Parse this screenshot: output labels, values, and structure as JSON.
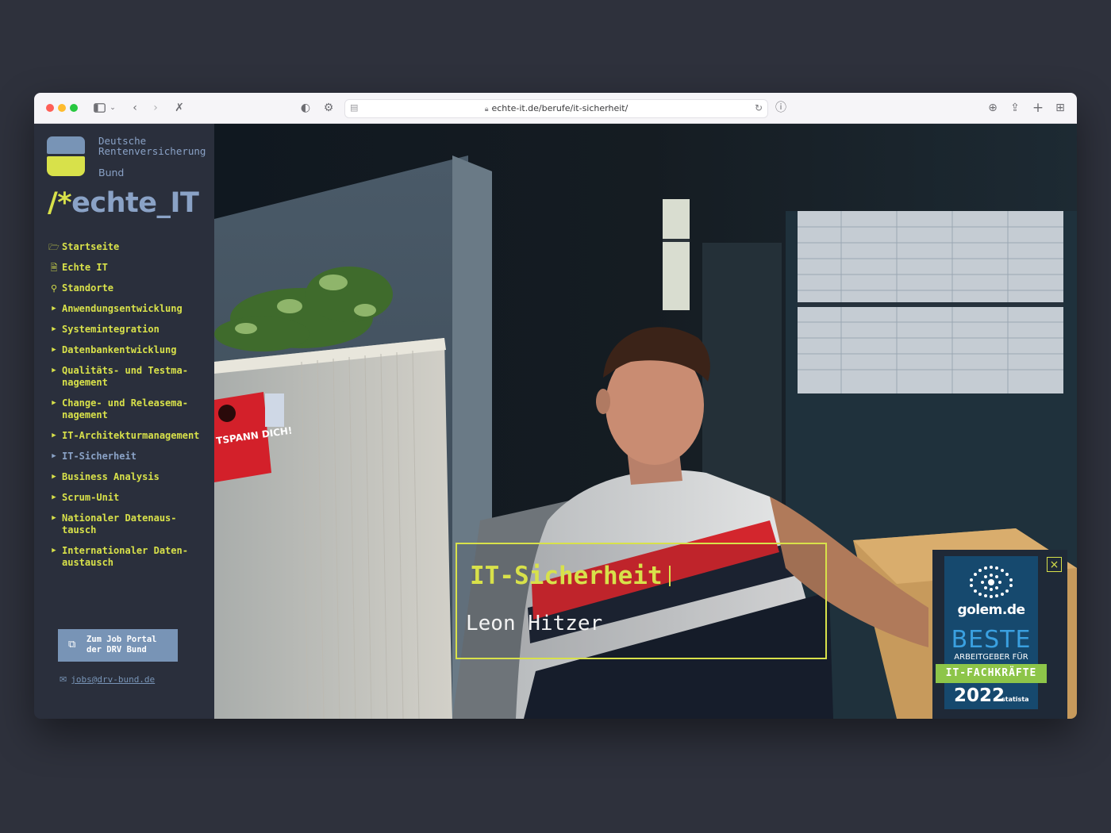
{
  "browser": {
    "url": "echte-it.de/berufe/it-sicherheit/"
  },
  "sidebar": {
    "org_line1": "Deutsche",
    "org_line2": "Rentenversicherung",
    "org_line3": "Bund",
    "brand_prefix": "/*",
    "brand_word": "echte_IT",
    "nav": [
      {
        "label": "Startseite",
        "icon": "folder-icon",
        "active": false
      },
      {
        "label": "Echte IT",
        "icon": "document-icon",
        "active": false
      },
      {
        "label": "Standorte",
        "icon": "map-pin-icon",
        "active": false
      },
      {
        "label": "Anwendungsentwicklung",
        "icon": "triangle-right-icon",
        "active": false
      },
      {
        "label": "Systemintegration",
        "icon": "triangle-right-icon",
        "active": false
      },
      {
        "label": "Datenbankentwicklung",
        "icon": "triangle-right-icon",
        "active": false
      },
      {
        "label": "Qualitäts- und Testma-\nnagement",
        "icon": "triangle-right-icon",
        "active": false
      },
      {
        "label": "Change- und Releasema-\nnagement",
        "icon": "triangle-right-icon",
        "active": false
      },
      {
        "label": "IT-Architekturmanagement",
        "icon": "triangle-right-icon",
        "active": false
      },
      {
        "label": "IT-Sicherheit",
        "icon": "triangle-right-icon",
        "active": true
      },
      {
        "label": "Business Analysis",
        "icon": "triangle-right-icon",
        "active": false
      },
      {
        "label": "Scrum-Unit",
        "icon": "triangle-right-icon",
        "active": false
      },
      {
        "label": "Nationaler Datenaus-\ntausch",
        "icon": "triangle-right-icon",
        "active": false
      },
      {
        "label": "Internationaler Daten-\naustausch",
        "icon": "triangle-right-icon",
        "active": false
      }
    ],
    "job_button_line1": "Zum Job Portal",
    "job_button_line2": "der DRV Bund",
    "email": "jobs@drv-bund.de"
  },
  "hero": {
    "title": "IT-Sicherheit",
    "name": "Leon Hitzer",
    "poster_text": "TSPANN DICH!"
  },
  "badge": {
    "site": "golem.de",
    "beste": "BESTE",
    "arbeitgeber": "ARBEITGEBER FÜR",
    "band": "IT-FACHKRÄFTE",
    "year": "2022",
    "source": "statista"
  },
  "colors": {
    "accent": "#d8e14a",
    "blue": "#7894b6",
    "sidebar_bg": "#2a2f3c",
    "page_bg": "#2e313c"
  }
}
